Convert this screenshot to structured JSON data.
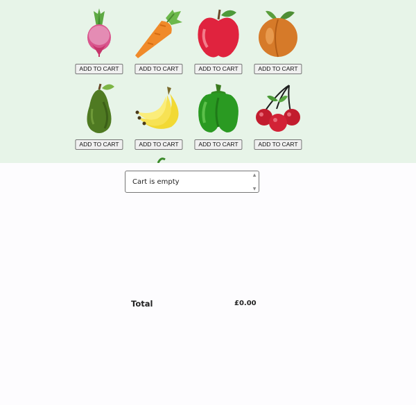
{
  "products": [
    {
      "name": "radish-icon",
      "button_label": "ADD TO CART"
    },
    {
      "name": "carrot-icon",
      "button_label": "ADD TO CART"
    },
    {
      "name": "apple-icon",
      "button_label": "ADD TO CART"
    },
    {
      "name": "peach-icon",
      "button_label": "ADD TO CART"
    },
    {
      "name": "avocado-icon",
      "button_label": "ADD TO CART"
    },
    {
      "name": "banana-icon",
      "button_label": "ADD TO CART"
    },
    {
      "name": "green-pepper-icon",
      "button_label": "ADD TO CART"
    },
    {
      "name": "cherry-icon",
      "button_label": "ADD TO CART"
    }
  ],
  "cart": {
    "empty_text": "Cart is empty",
    "total_label": "Total",
    "total_value": "£0.00"
  },
  "colors": {
    "shop_background": "#e7f4e8",
    "page_background": "#fdfcfe"
  }
}
